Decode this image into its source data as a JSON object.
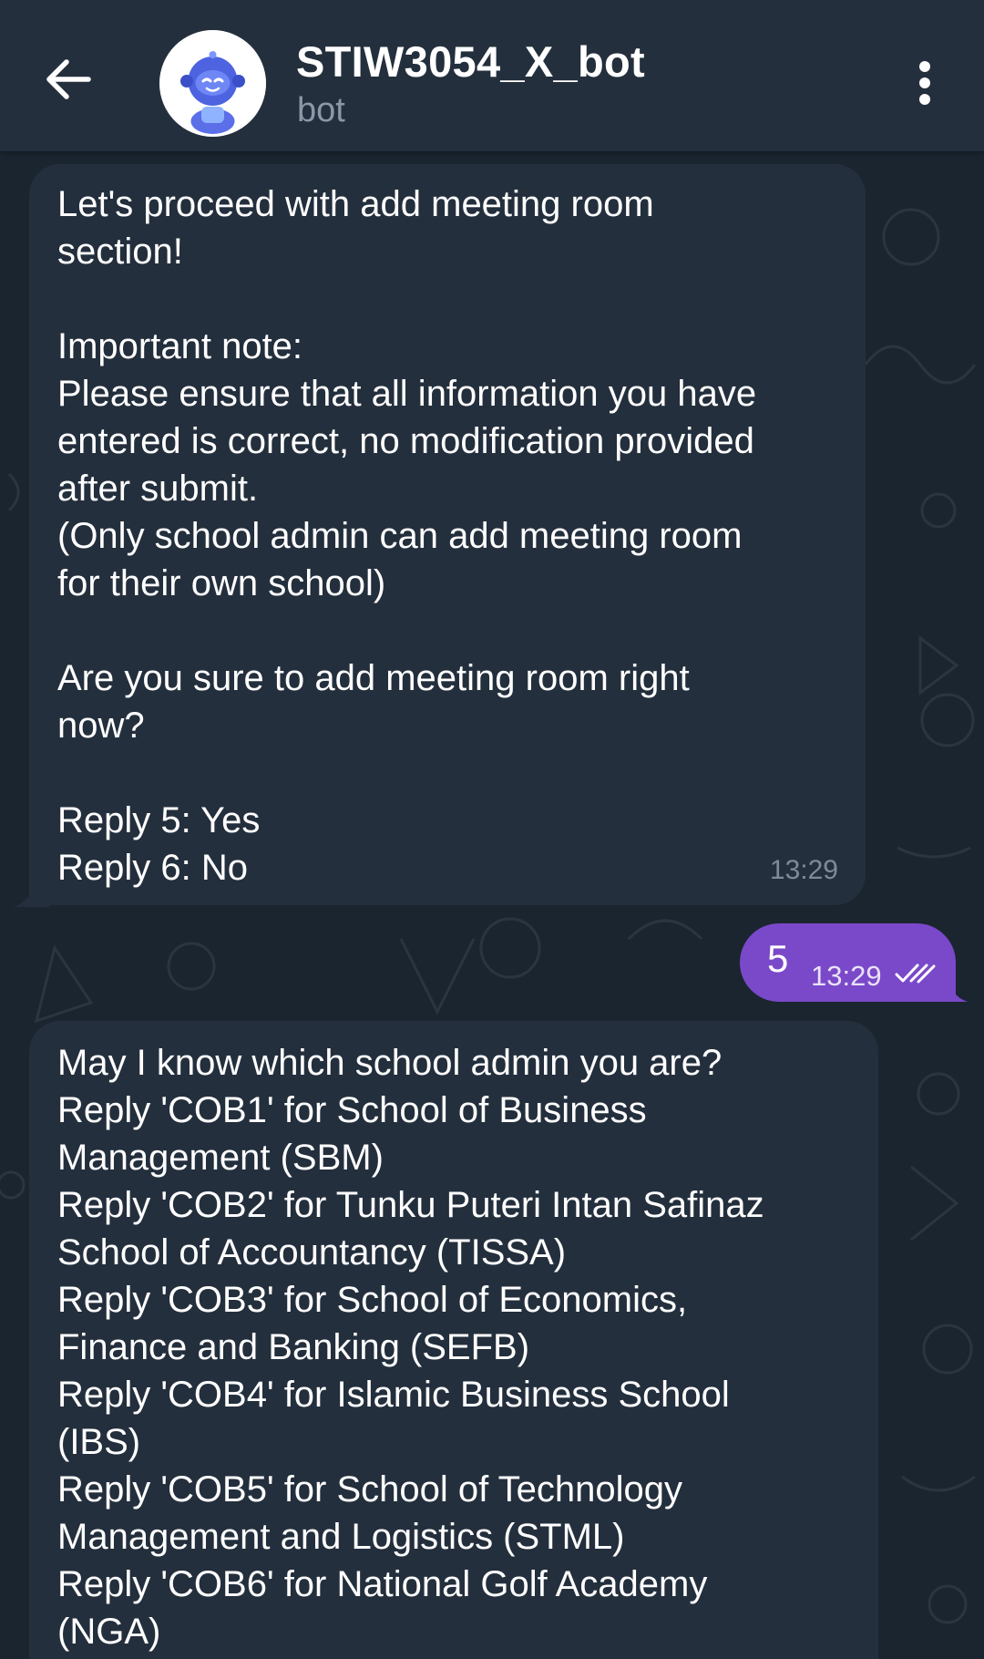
{
  "header": {
    "title": "STIW3054_X_bot",
    "subtitle": "bot",
    "back_icon": "arrow-left-icon",
    "menu_icon": "more-vertical-icon",
    "avatar_icon": "robot-avatar-icon"
  },
  "messages": [
    {
      "direction": "incoming",
      "lines": [
        "Let's proceed with add meeting room",
        "section!",
        "",
        "Important note:",
        "Please ensure that all information you have",
        "entered is correct, no modification provided",
        "after submit.",
        "(Only school admin can add meeting room",
        "for their own school)",
        "",
        "Are you sure to add meeting room right",
        "now?",
        "",
        "Reply 5: Yes",
        "Reply 6: No"
      ],
      "time": "13:29"
    },
    {
      "direction": "outgoing",
      "text": "5",
      "time": "13:29",
      "status_icon": "double-check-icon"
    },
    {
      "direction": "incoming",
      "lines": [
        "May I know which school admin you are?",
        "Reply 'COB1' for School of Business",
        "Management (SBM)",
        "Reply 'COB2' for Tunku Puteri Intan Safinaz",
        "School of Accountancy (TISSA)",
        "Reply 'COB3' for School of Economics,",
        "Finance and Banking (SEFB)",
        "Reply 'COB4' for Islamic Business School",
        "(IBS)",
        "Reply 'COB5' for School of Technology",
        "Management and Logistics (STML)",
        "Reply 'COB6' for National Golf Academy",
        "(NGA)"
      ]
    }
  ],
  "colors": {
    "header_bg": "#242f3d",
    "chat_bg": "#1b2530",
    "incoming_bubble": "#242f3d",
    "outgoing_bubble": "#7a49c9",
    "timestamp": "#7d8b99"
  }
}
